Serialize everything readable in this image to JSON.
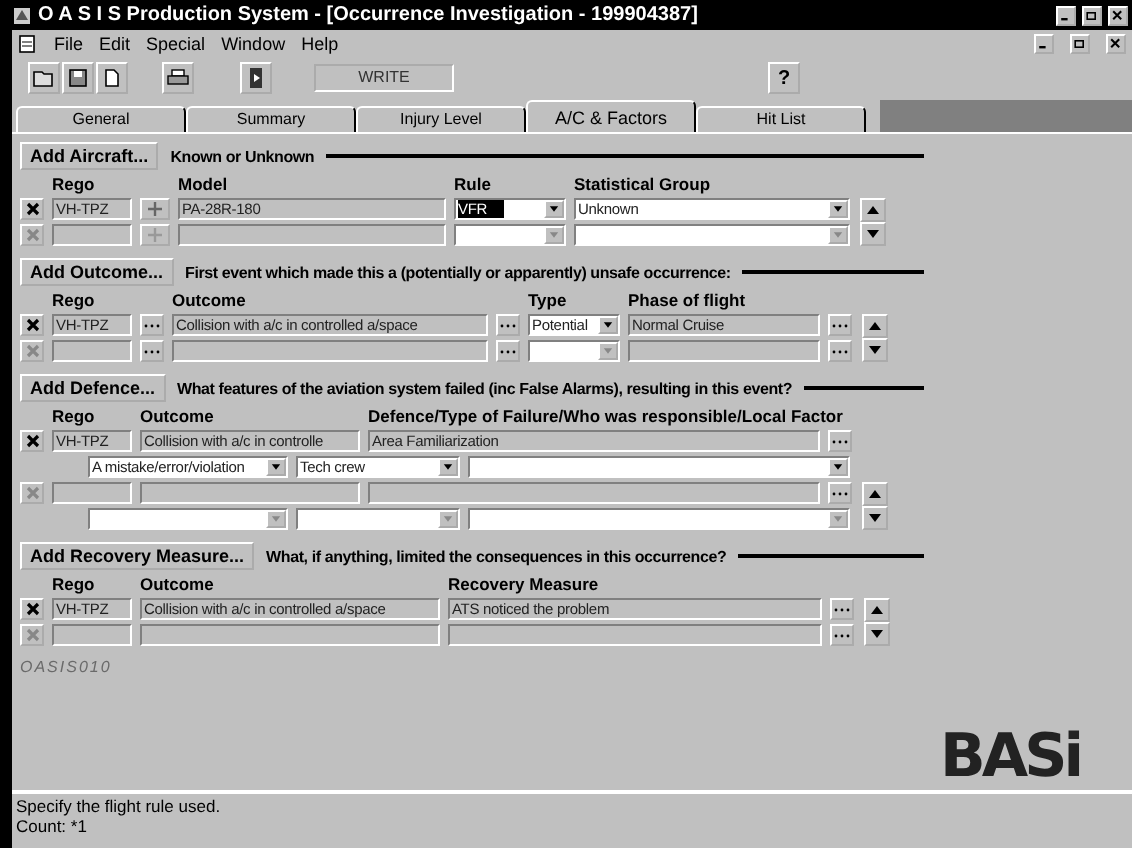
{
  "window": {
    "title": "O A S I S Production System - [Occurrence Investigation - 199904387]"
  },
  "menu": [
    "File",
    "Edit",
    "Special",
    "Window",
    "Help"
  ],
  "toolbar": {
    "mode": "WRITE",
    "help": "?"
  },
  "tabs": [
    {
      "label": "General",
      "selected": false
    },
    {
      "label": "Summary",
      "selected": false
    },
    {
      "label": "Injury Level",
      "selected": false
    },
    {
      "label": "A/C & Factors",
      "selected": true
    },
    {
      "label": "Hit List",
      "selected": false
    }
  ],
  "aircraft": {
    "button": "Add Aircraft...",
    "heading": "Known or Unknown",
    "columns": [
      "Rego",
      "Model",
      "Rule",
      "Statistical Group"
    ],
    "rows": [
      {
        "enabled": true,
        "rego": "VH-TPZ",
        "model": "PA-28R-180",
        "rule": "VFR",
        "rule_focused": true,
        "group": "Unknown"
      },
      {
        "enabled": false,
        "rule_focused": false
      }
    ]
  },
  "outcome": {
    "button": "Add Outcome...",
    "heading": "First event which made this a (potentially or apparently) unsafe occurrence:",
    "columns": [
      "Rego",
      "Outcome",
      "Type",
      "Phase of flight"
    ],
    "rows": [
      {
        "enabled": true,
        "rego": "VH-TPZ",
        "outcome": "Collision with a/c in controlled a/space",
        "type": "Potential",
        "phase": "Normal Cruise"
      },
      {
        "enabled": false
      }
    ]
  },
  "defence": {
    "button": "Add Defence...",
    "heading": "What features of the aviation system failed (inc False Alarms), resulting in this event?",
    "columns": [
      "Rego",
      "Outcome",
      "Defence/Type of Failure/Who was responsible/Local Factor"
    ],
    "rows": [
      {
        "enabled": true,
        "rego": "VH-TPZ",
        "outcome": "Collision with a/c in controlle",
        "defence": "Area Familiarization",
        "failure": "A mistake/error/violation",
        "who": "Tech crew"
      },
      {
        "enabled": false
      }
    ]
  },
  "recovery": {
    "button": "Add Recovery Measure...",
    "heading": "What, if anything, limited the consequences in this occurrence?",
    "columns": [
      "Rego",
      "Outcome",
      "Recovery Measure"
    ],
    "rows": [
      {
        "enabled": true,
        "rego": "VH-TPZ",
        "outcome": "Collision with a/c in controlled a/space",
        "measure": "ATS noticed the problem"
      },
      {
        "enabled": false
      }
    ]
  },
  "form_id": "OASIS010",
  "logo": "BASi",
  "status_bar": [
    "Specify the flight rule used.",
    "Count: *1"
  ]
}
